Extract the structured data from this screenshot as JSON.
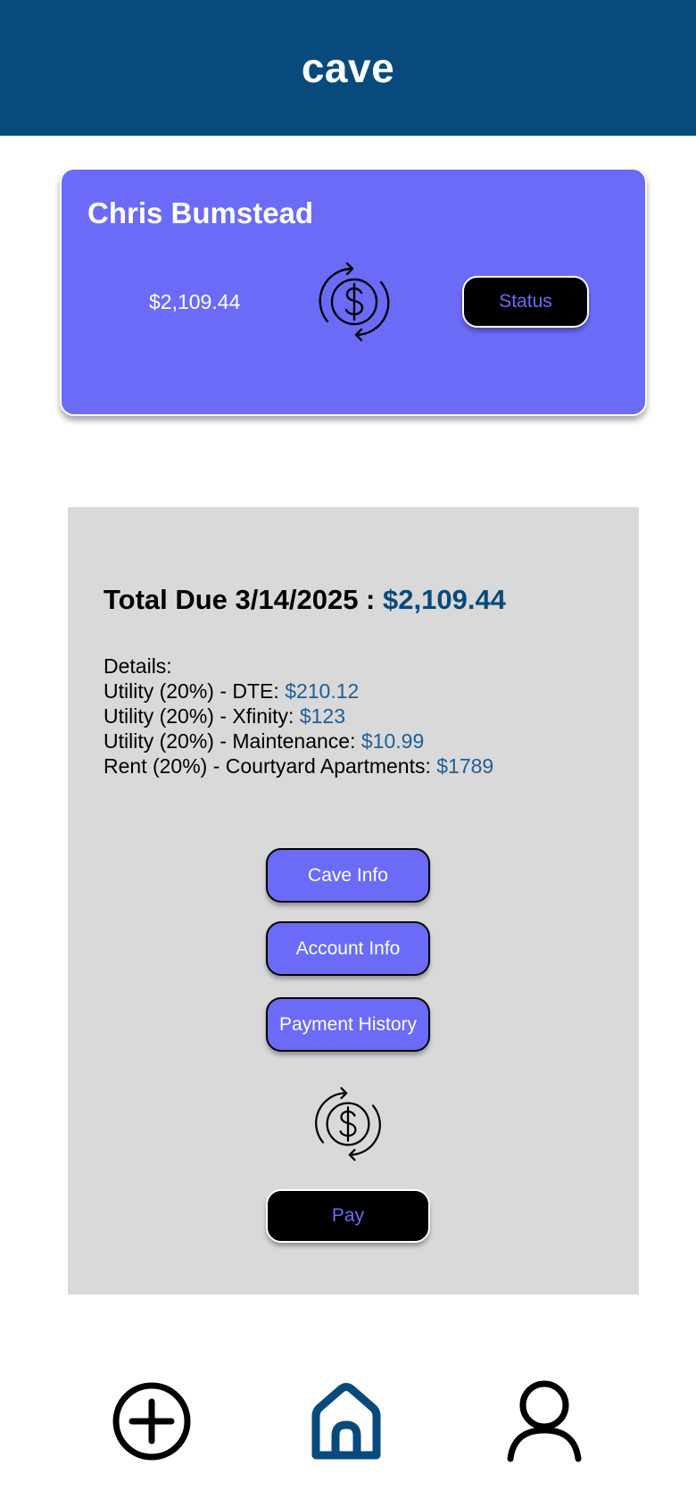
{
  "header": {
    "title": "cave"
  },
  "member_card": {
    "name": "Chris Bumstead",
    "amount": "$2,109.44",
    "icon": "dollar-exchange-icon",
    "status_label": "Status"
  },
  "details": {
    "total_label": "Total Due 3/14/2025 :",
    "total_amount": "$2,109.44",
    "heading": "Details:",
    "items": [
      {
        "label": "Utility (20%) - DTE:",
        "value": "$210.12"
      },
      {
        "label": "Utility (20%) - Xfinity:",
        "value": "$123"
      },
      {
        "label": "Utility (20%) - Maintenance:",
        "value": "$10.99"
      },
      {
        "label": "Rent (20%) - Courtyard Apartments:",
        "value": "$1789"
      }
    ],
    "buttons": {
      "cave_info": "Cave Info",
      "account_info": "Account Info",
      "payment_history": "Payment History",
      "pay": "Pay"
    },
    "icon": "dollar-exchange-icon"
  },
  "bottom_nav": {
    "items": [
      {
        "name": "add",
        "icon": "plus-circle-icon"
      },
      {
        "name": "home",
        "icon": "home-icon",
        "active": true
      },
      {
        "name": "profile",
        "icon": "user-icon"
      }
    ]
  },
  "colors": {
    "header_bg": "#074a7b",
    "accent_purple": "#6b6bf8",
    "panel_gray": "#d9d9d9",
    "value_blue": "#1f5f95",
    "black": "#000000"
  }
}
